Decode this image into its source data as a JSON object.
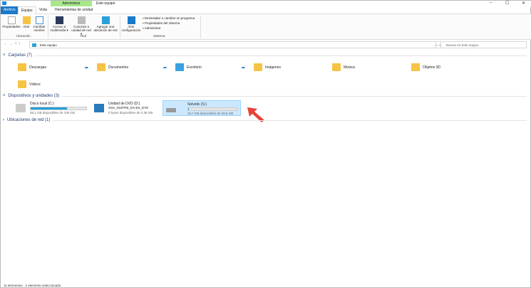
{
  "window": {
    "title": "Este equipo",
    "context_tab": "Administrar",
    "minimize": "–",
    "maximize": "☐",
    "close": "✕"
  },
  "tabs": [
    {
      "label": "Archivo"
    },
    {
      "label": "Equipo"
    },
    {
      "label": "Vista"
    },
    {
      "label": "Herramientas de unidad"
    }
  ],
  "ribbon": {
    "ubicacion": {
      "label": "Ubicación",
      "buttons": [
        "Propiedades",
        "Abrir",
        "Cambiar nombre"
      ]
    },
    "red": {
      "label": "Red",
      "buttons": [
        "Acceso a multimedia ▾",
        "Conectar a unidad de red ▾",
        "Agregar una ubicación de red"
      ]
    },
    "sistema": {
      "label": "Sistema",
      "open": "Abrir configuración",
      "items": [
        "Desinstalar o cambiar un programa",
        "Propiedades del sistema",
        "Administrar"
      ]
    }
  },
  "address": {
    "path": "Este equipo",
    "search_placeholder": "Buscar en Este equipo"
  },
  "sections": {
    "folders": {
      "title": "Carpetas (7)",
      "items": [
        "Descargas",
        "Documentos",
        "Escritorio",
        "Imágenes",
        "Música",
        "Objetos 3D",
        "Vídeos"
      ]
    },
    "drives": {
      "title": "Dispositivos y unidades (3)",
      "items": [
        {
          "name": "Disco local (C:)",
          "sub": "35,1 GB disponibles de 100 GB",
          "used_percent": 65
        },
        {
          "name": "Unidad de DVD (D:)",
          "line2": "SSS_X64FRE_ES-ES_DV9",
          "sub": "0 bytes disponibles de 4,38 GB"
        },
        {
          "name": "Solvetic (S:)",
          "sub": "28,7 GB disponibles de 28,8 GB",
          "used_percent": 1
        }
      ]
    },
    "network": {
      "title": "Ubicaciones de red (1)"
    }
  },
  "status": {
    "count": "11 elementos",
    "selected": "1 elemento seleccionado"
  },
  "colors": {
    "accent": "#1979ca",
    "selection": "#cce8ff",
    "arrow": "#e8423b"
  }
}
